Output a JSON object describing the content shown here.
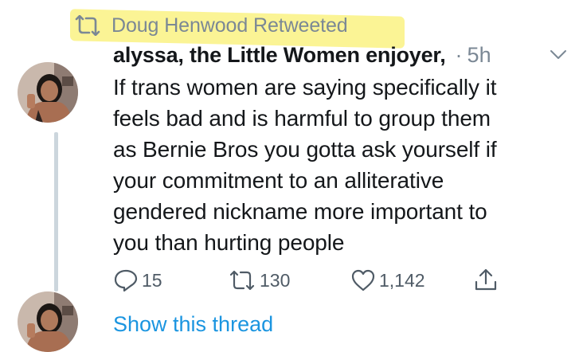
{
  "retweet": {
    "text": "Doug Henwood Retweeted",
    "icon": "retweet-icon"
  },
  "tweet": {
    "author": "alyssa, the Little Women enjoyer,",
    "dot": "·",
    "time": "5h",
    "text": "If trans women are saying specifically it\nfeels bad and is harmful to group them\nas Bernie Bros you gotta ask yourself if\nyour commitment to an alliterative\ngendered nickname more important to\nyou than hurting people",
    "actions": {
      "reply_count": "15",
      "retweet_count": "130",
      "like_count": "1,142"
    }
  },
  "thread": {
    "link_text": "Show this thread"
  },
  "colors": {
    "muted": "#7b8895",
    "link": "#1b95e0",
    "highlight": "#fbf38a",
    "thread_line": "#ccd6dd"
  }
}
